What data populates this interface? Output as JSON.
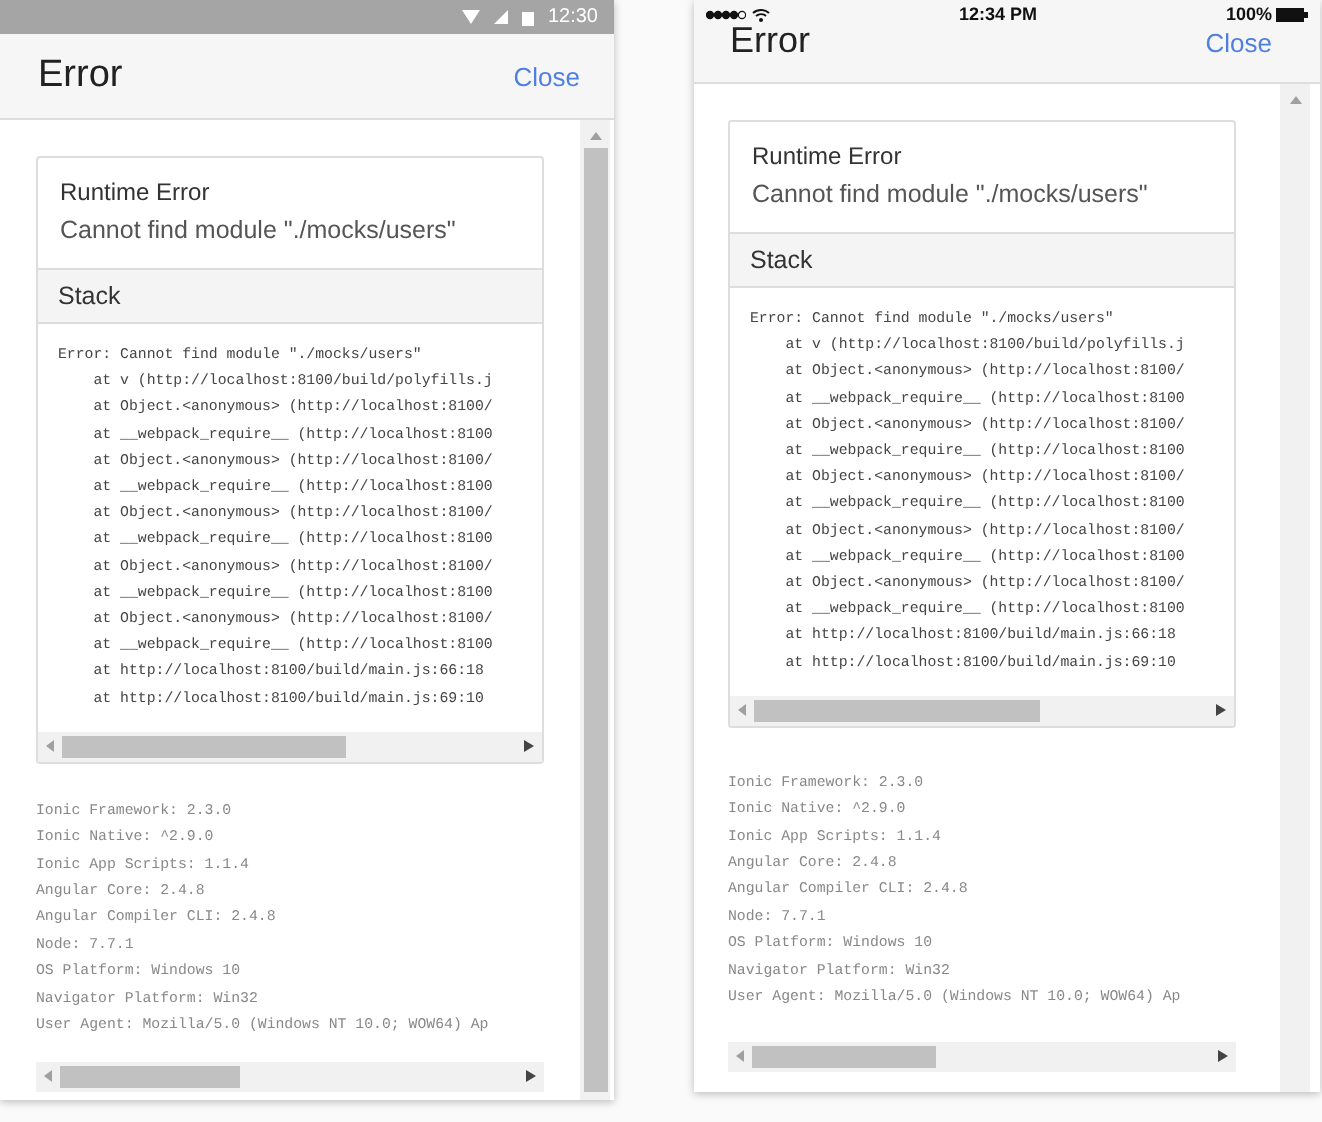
{
  "screens": [
    {
      "kind": "android",
      "status_bar": {
        "time": "12:30"
      },
      "header": {
        "title": "Error",
        "close": "Close"
      },
      "error": {
        "title": "Runtime Error",
        "message": "Cannot find module \"./mocks/users\""
      },
      "stack": {
        "heading": "Stack",
        "lines": [
          "Error: Cannot find module \"./mocks/users\"",
          "    at v (http://localhost:8100/build/polyfills.j",
          "    at Object.<anonymous> (http://localhost:8100/",
          "    at __webpack_require__ (http://localhost:8100",
          "    at Object.<anonymous> (http://localhost:8100/",
          "    at __webpack_require__ (http://localhost:8100",
          "    at Object.<anonymous> (http://localhost:8100/",
          "    at __webpack_require__ (http://localhost:8100",
          "    at Object.<anonymous> (http://localhost:8100/",
          "    at __webpack_require__ (http://localhost:8100",
          "    at Object.<anonymous> (http://localhost:8100/",
          "    at __webpack_require__ (http://localhost:8100",
          "    at http://localhost:8100/build/main.js:66:18",
          "    at http://localhost:8100/build/main.js:69:10"
        ]
      },
      "env_lines": [
        "Ionic Framework: 2.3.0",
        "Ionic Native: ^2.9.0",
        "Ionic App Scripts: 1.1.4",
        "Angular Core: 2.4.8",
        "Angular Compiler CLI: 2.4.8",
        "Node: 7.7.1",
        "OS Platform: Windows 10",
        "Navigator Platform: Win32",
        "User Agent: Mozilla/5.0 (Windows NT 10.0; WOW64) Ap"
      ]
    },
    {
      "kind": "ios",
      "status_bar": {
        "time": "12:34 PM",
        "battery": "100%"
      },
      "header": {
        "title": "Error",
        "close": "Close"
      },
      "error": {
        "title": "Runtime Error",
        "message": "Cannot find module \"./mocks/users\""
      },
      "stack": {
        "heading": "Stack",
        "lines": [
          "Error: Cannot find module \"./mocks/users\"",
          "    at v (http://localhost:8100/build/polyfills.j",
          "    at Object.<anonymous> (http://localhost:8100/",
          "    at __webpack_require__ (http://localhost:8100",
          "    at Object.<anonymous> (http://localhost:8100/",
          "    at __webpack_require__ (http://localhost:8100",
          "    at Object.<anonymous> (http://localhost:8100/",
          "    at __webpack_require__ (http://localhost:8100",
          "    at Object.<anonymous> (http://localhost:8100/",
          "    at __webpack_require__ (http://localhost:8100",
          "    at Object.<anonymous> (http://localhost:8100/",
          "    at __webpack_require__ (http://localhost:8100",
          "    at http://localhost:8100/build/main.js:66:18",
          "    at http://localhost:8100/build/main.js:69:10"
        ]
      },
      "env_lines": [
        "Ionic Framework: 2.3.0",
        "Ionic Native: ^2.9.0",
        "Ionic App Scripts: 1.1.4",
        "Angular Core: 2.4.8",
        "Angular Compiler CLI: 2.4.8",
        "Node: 7.7.1",
        "OS Platform: Windows 10",
        "Navigator Platform: Win32",
        "User Agent: Mozilla/5.0 (Windows NT 10.0; WOW64) Ap"
      ]
    }
  ]
}
